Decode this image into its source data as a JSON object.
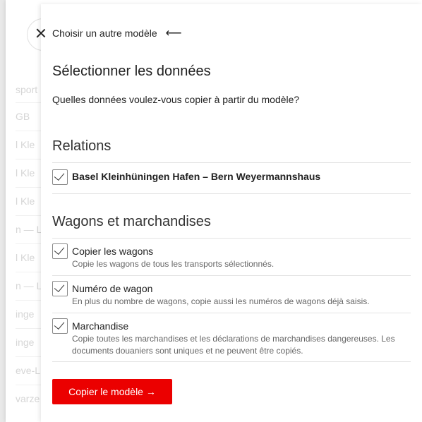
{
  "background": {
    "items": [
      "sport",
      "GB",
      "l Kle",
      "l Kle",
      "l Kle",
      "n — L",
      "l Kle",
      "n — L",
      "inge",
      "inge",
      "eve-L",
      "varze"
    ]
  },
  "modal": {
    "back_label": "Choisir un autre modèle",
    "close_icon": "close-icon",
    "arrow_icon": "arrow-left-icon",
    "title": "Sélectionner les données",
    "question": "Quelles données voulez-vous copier à partir du modèle?",
    "relations": {
      "title": "Relations",
      "item": {
        "label": "Basel Kleinhüningen Hafen – Bern Weyermannshaus",
        "checked": true
      }
    },
    "wagons": {
      "title": "Wagons et marchandises",
      "items": [
        {
          "label": "Copier les wagons",
          "desc": "Copie les wagons de tous les transports sélectionnés.",
          "checked": true
        },
        {
          "label": "Numéro de wagon",
          "desc": "En plus du nombre de wagons, copie aussi les numéros de wagons déjà saisis.",
          "checked": true
        },
        {
          "label": "Marchandise",
          "desc": "Copie toutes les marchandises et les déclarations de marchandises dangereuses. Les documents douaniers sont uniques et ne peuvent être copiés.",
          "checked": true
        }
      ]
    },
    "submit_label": "Copier le modèle →",
    "accent_color": "#eb0000"
  }
}
